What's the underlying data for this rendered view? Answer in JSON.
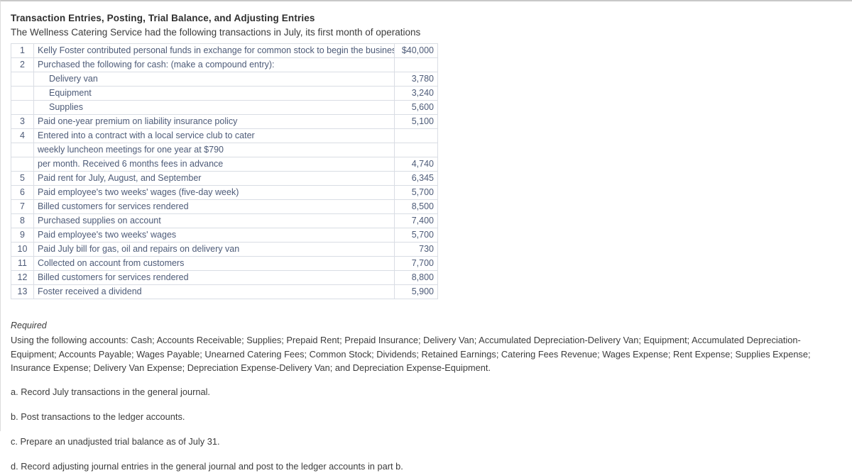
{
  "document": {
    "title": "Transaction Entries, Posting, Trial Balance, and Adjusting Entries",
    "subtitle": "The Wellness Catering Service had the following transactions in July, its first month of operations"
  },
  "table": {
    "rows": [
      {
        "num": "1",
        "desc": "Kelly Foster contributed personal funds in exchange for common stock to begin the business.",
        "amount": "$40,000",
        "indent": false
      },
      {
        "num": "2",
        "desc": "Purchased the following for cash: (make a compound entry):",
        "amount": "",
        "indent": false
      },
      {
        "num": "",
        "desc": "Delivery van",
        "amount": "3,780",
        "indent": true
      },
      {
        "num": "",
        "desc": "Equipment",
        "amount": "3,240",
        "indent": true
      },
      {
        "num": "",
        "desc": "Supplies",
        "amount": "5,600",
        "indent": true
      },
      {
        "num": "3",
        "desc": "Paid one-year premium on liability insurance policy",
        "amount": "5,100",
        "indent": false
      },
      {
        "num": "4",
        "desc": "Entered into a contract with a local service club to cater",
        "amount": "",
        "indent": false
      },
      {
        "num": "",
        "desc": "weekly luncheon meetings for one year at $790",
        "amount": "",
        "indent": false
      },
      {
        "num": "",
        "desc": "per month. Received 6 months fees in advance",
        "amount": "4,740",
        "indent": false
      },
      {
        "num": "5",
        "desc": "Paid rent for July, August, and September",
        "amount": "6,345",
        "indent": false
      },
      {
        "num": "6",
        "desc": "Paid employee's two weeks' wages (five-day week)",
        "amount": "5,700",
        "indent": false
      },
      {
        "num": "7",
        "desc": "Billed customers for services rendered",
        "amount": "8,500",
        "indent": false
      },
      {
        "num": "8",
        "desc": "Purchased supplies on account",
        "amount": "7,400",
        "indent": false
      },
      {
        "num": "9",
        "desc": "Paid employee's two weeks' wages",
        "amount": "5,700",
        "indent": false
      },
      {
        "num": "10",
        "desc": "Paid July bill for gas, oil and repairs on delivery van",
        "amount": "730",
        "indent": false
      },
      {
        "num": "11",
        "desc": "Collected on account from customers",
        "amount": "7,700",
        "indent": false
      },
      {
        "num": "12",
        "desc": "Billed customers for services rendered",
        "amount": "8,800",
        "indent": false
      },
      {
        "num": "13",
        "desc": "Foster received a dividend",
        "amount": "5,900",
        "indent": false
      }
    ]
  },
  "required": {
    "label": "Required",
    "body": "Using the following accounts: Cash; Accounts Receivable; Supplies; Prepaid Rent; Prepaid Insurance; Delivery Van; Accumulated Depreciation-Delivery Van; Equipment; Accumulated Depreciation-Equipment; Accounts Payable; Wages Payable; Unearned Catering Fees; Common Stock; Dividends; Retained Earnings; Catering Fees Revenue; Wages Expense; Rent Expense; Supplies Expense; Insurance Expense; Delivery Van Expense; Depreciation Expense-Delivery Van; and Depreciation Expense-Equipment.",
    "tasks": [
      "a. Record July transactions in the general journal.",
      "b. Post transactions to the ledger accounts.",
      "c. Prepare an unadjusted trial balance as of July 31.",
      "d. Record adjusting journal entries in the general journal and post to the ledger accounts in part b."
    ]
  }
}
